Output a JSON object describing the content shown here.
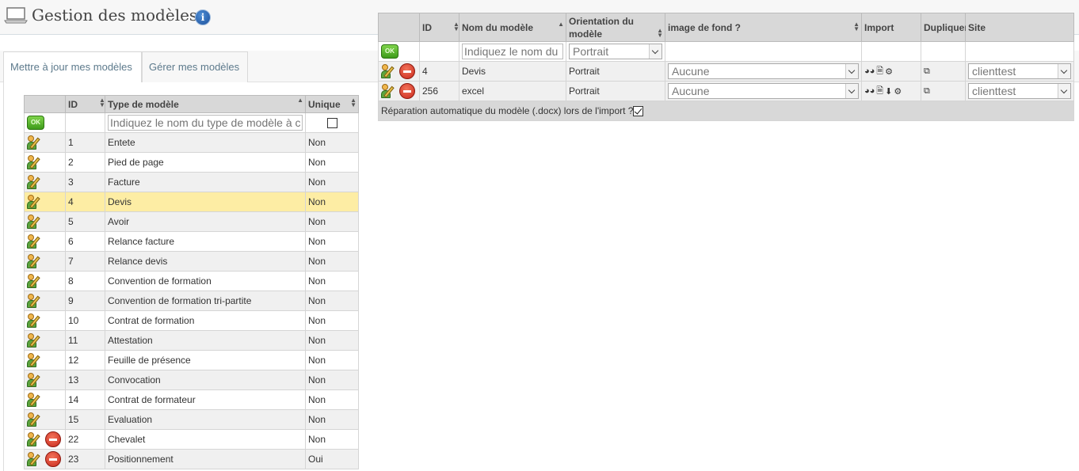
{
  "header": {
    "title": "Gestion des modèles",
    "icon": "laptop-icon",
    "info_icon": "info-icon"
  },
  "tabs": [
    {
      "label": "Mettre à jour mes modèles",
      "active": true
    },
    {
      "label": "Gérer mes modèles",
      "active": false
    }
  ],
  "types_table": {
    "headers": {
      "id": "ID",
      "type": "Type de modèle",
      "unique": "Unique"
    },
    "new_row": {
      "placeholder": "Indiquez le nom du type de modèle à cr",
      "ok_label": "OK"
    },
    "rows": [
      {
        "id": "1",
        "type": "Entete",
        "unique": "Non",
        "deletable": false
      },
      {
        "id": "2",
        "type": "Pied de page",
        "unique": "Non",
        "deletable": false
      },
      {
        "id": "3",
        "type": "Facture",
        "unique": "Non",
        "deletable": false
      },
      {
        "id": "4",
        "type": "Devis",
        "unique": "Non",
        "deletable": false,
        "selected": true
      },
      {
        "id": "5",
        "type": "Avoir",
        "unique": "Non",
        "deletable": false
      },
      {
        "id": "6",
        "type": "Relance facture",
        "unique": "Non",
        "deletable": false
      },
      {
        "id": "7",
        "type": "Relance devis",
        "unique": "Non",
        "deletable": false
      },
      {
        "id": "8",
        "type": "Convention de formation",
        "unique": "Non",
        "deletable": false
      },
      {
        "id": "9",
        "type": "Convention de formation tri-partite",
        "unique": "Non",
        "deletable": false
      },
      {
        "id": "10",
        "type": "Contrat de formation",
        "unique": "Non",
        "deletable": false
      },
      {
        "id": "11",
        "type": "Attestation",
        "unique": "Non",
        "deletable": false
      },
      {
        "id": "12",
        "type": "Feuille de présence",
        "unique": "Non",
        "deletable": false
      },
      {
        "id": "13",
        "type": "Convocation",
        "unique": "Non",
        "deletable": false
      },
      {
        "id": "14",
        "type": "Contrat de formateur",
        "unique": "Non",
        "deletable": false
      },
      {
        "id": "15",
        "type": "Evaluation",
        "unique": "Non",
        "deletable": false
      },
      {
        "id": "22",
        "type": "Chevalet",
        "unique": "Non",
        "deletable": true
      },
      {
        "id": "23",
        "type": "Positionnement",
        "unique": "Oui",
        "deletable": true
      }
    ]
  },
  "models_table": {
    "headers": {
      "id": "ID",
      "name": "Nom du modèle",
      "orientation": "Orientation du modèle",
      "background": "image de fond ?",
      "import": "Import",
      "duplicate": "Dupliquer",
      "site": "Site"
    },
    "new_row": {
      "placeholder": "Indiquez le nom du ty",
      "orientation": "Portrait"
    },
    "rows": [
      {
        "id": "4",
        "name": "Devis",
        "orientation": "Portrait",
        "background": "Aucune",
        "site": "clienttest",
        "has_download": false
      },
      {
        "id": "256",
        "name": "excel",
        "orientation": "Portrait",
        "background": "Aucune",
        "site": "clienttest",
        "has_download": true
      }
    ],
    "footer": "Réparation automatique du modèle (.docx) lors de l'import ?",
    "footer_checked": true
  }
}
